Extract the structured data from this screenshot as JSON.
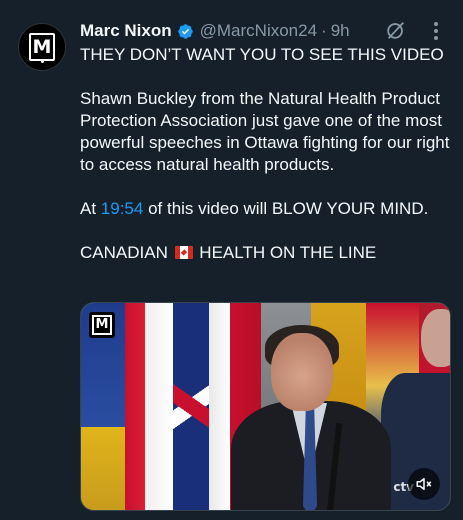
{
  "author": {
    "name": "Marc Nixon",
    "handle": "@MarcNixon24",
    "separator": "·",
    "time": "9h",
    "avatar_letter": "M"
  },
  "tweet": {
    "line1": "THEY DON’T WANT YOU TO SEE THIS VIDEO",
    "para2": "Shawn Buckley from the Natural Health Product Protection Association just gave one of the most powerful speeches in Ottawa fighting for our right to access natural health products.",
    "para3_before": "At ",
    "para3_link": "19:54",
    "para3_after": " of this video will BLOW YOUR MIND.",
    "para4_before": "CANADIAN ",
    "para4_after": " HEALTH ON THE LINE"
  },
  "media": {
    "logo_letter": "M",
    "watermark": "ctv"
  },
  "icons": {
    "verified": "verified-badge-icon",
    "grok": "grok-icon",
    "more": "more-icon",
    "flag": "canada-flag-icon",
    "mute": "speaker-mute-icon"
  },
  "colors": {
    "background": "#15202b",
    "text": "#f5f8fa",
    "muted": "#8899a6",
    "link": "#1d9bf0"
  }
}
